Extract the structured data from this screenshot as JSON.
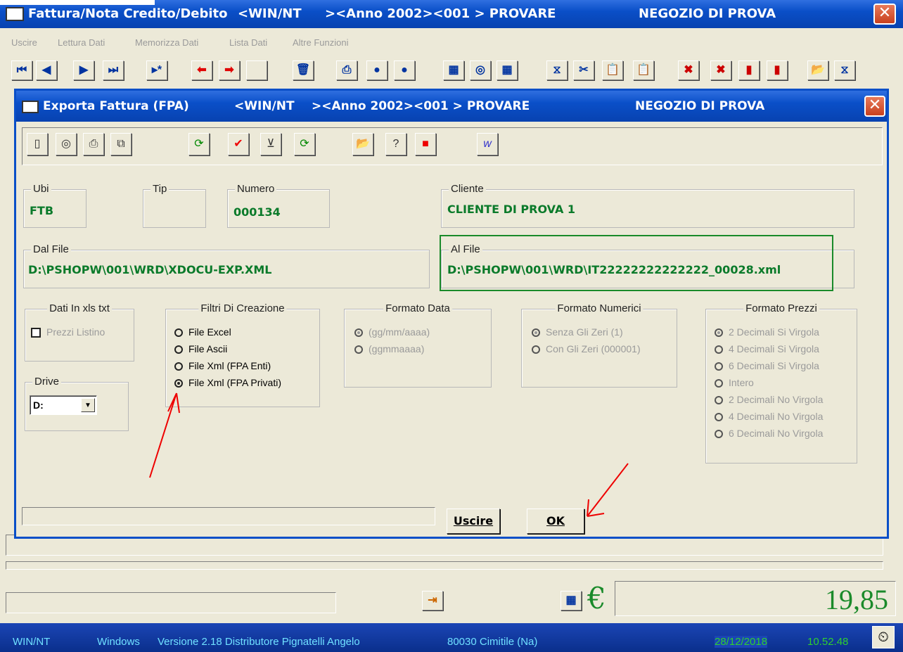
{
  "app": {
    "title": "Fattura/Nota Credito/Debito",
    "win": "<WIN/NT",
    "anno": "><Anno 2002><001 > PROVARE",
    "negozio": "NEGOZIO DI PROVA",
    "close_glyph": "✕"
  },
  "menu": [
    "Uscire",
    "Lettura Dati",
    "Memorizza Dati",
    "Lista Dati",
    "Altre Funzioni"
  ],
  "toolbar_icons": [
    "first-icon",
    "prev-icon",
    "next-icon",
    "last-icon",
    "new-record-icon",
    "arrow-left-icon",
    "arrow-right-icon",
    "blank-icon",
    "trash-icon",
    "print-icon",
    "save-icon",
    "undo-icon",
    "calc-icon",
    "copy-icon",
    "calc2-icon",
    "filter-icon",
    "cut-icon",
    "paste-icon",
    "paste2-icon",
    "clear-icon",
    "clear2-icon",
    "book-icon",
    "book2-icon",
    "open-folder-icon",
    "filter2-icon"
  ],
  "dialog": {
    "title": "Exporta Fattura (FPA)",
    "win": "<WIN/NT",
    "anno": "><Anno 2002><001 > PROVARE",
    "negozio": "NEGOZIO DI PROVA",
    "ubi_label": "Ubi",
    "ubi_value": "FTB",
    "tip_label": "Tip",
    "numero_label": "Numero",
    "numero_value": "000134",
    "cliente_label": "Cliente",
    "cliente_value": "CLIENTE DI PROVA 1",
    "dalfile_label": "Dal File",
    "dalfile_value": "D:\\PSHOPW\\001\\WRD\\XDOCU-EXP.XML",
    "alfile_label": "Al File",
    "alfile_value": "D:\\PSHOPW\\001\\WRD\\IT22222222222222_00028.xml",
    "dati_label": "Dati In xls txt",
    "prezzi_listino": "Prezzi Listino",
    "drive_label": "Drive",
    "drive_value": "D:",
    "filtri_label": "Filtri Di Creazione",
    "filtri": [
      "File Excel",
      "File Ascii",
      "File Xml (FPA Enti)",
      "File Xml (FPA Privati)"
    ],
    "filtri_selected": 3,
    "data_label": "Formato Data",
    "data_opts": [
      "(gg/mm/aaaa)",
      "(ggmmaaaa)"
    ],
    "num_label": "Formato Numerici",
    "num_opts": [
      "Senza Gli Zeri (1)",
      "Con Gli Zeri (000001)"
    ],
    "prezzi_label": "Formato Prezzi",
    "prezzi_opts": [
      "2 Decimali Si Virgola",
      "4 Decimali Si Virgola",
      "6 Decimali Si Virgola",
      "Intero",
      "2 Decimali No Virgola",
      "4 Decimali No Virgola",
      "6 Decimali No Virgola"
    ],
    "uscire": "Uscire",
    "ok": "OK"
  },
  "footer": {
    "total": "19,85",
    "euro": "€"
  },
  "status": {
    "os": "WIN/NT",
    "windows": "Windows",
    "version": "Versione 2.18 Distributore Pignatelli Angelo",
    "city": "80030 Cimitile (Na)",
    "date": "28/12/2018",
    "time": "10.52.48"
  },
  "colors": {
    "accent": "#0a4fc8",
    "green_value": "#0a7a2a",
    "status_green": "#2fd02f"
  }
}
